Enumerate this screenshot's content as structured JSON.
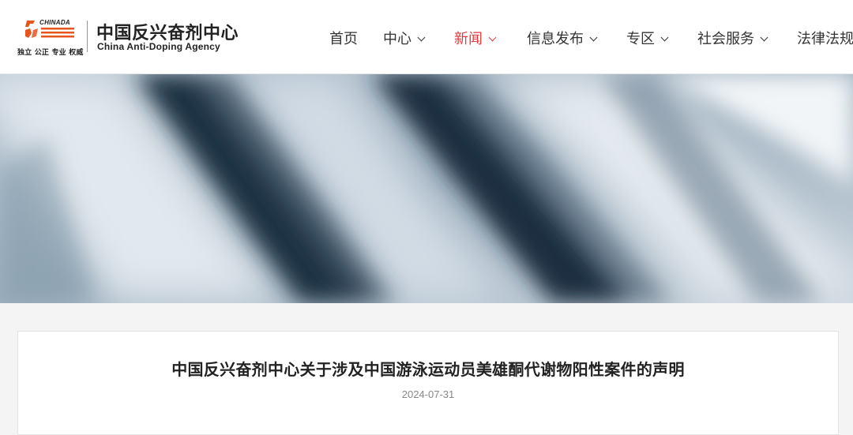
{
  "header": {
    "logo": {
      "brand_mark_text": "CHINADA",
      "motto": "独立 公正 专业 权威",
      "name_cn": "中国反兴奋剂中心",
      "name_en": "China Anti-Doping Agency"
    },
    "nav": [
      {
        "label": "首页",
        "dropdown": false,
        "active": false
      },
      {
        "label": "中心",
        "dropdown": true,
        "active": false
      },
      {
        "label": "新闻",
        "dropdown": true,
        "active": true
      },
      {
        "label": "信息发布",
        "dropdown": true,
        "active": false
      },
      {
        "label": "专区",
        "dropdown": true,
        "active": false
      },
      {
        "label": "社会服务",
        "dropdown": true,
        "active": false
      },
      {
        "label": "法律法规",
        "dropdown": false,
        "active": false
      }
    ]
  },
  "colors": {
    "accent": "#e4393c",
    "logo_orange": "#e8541e",
    "text": "#333333"
  },
  "article": {
    "title": "中国反兴奋剂中心关于涉及中国游泳运动员美雄酮代谢物阳性案件的声明",
    "date": "2024-07-31"
  }
}
